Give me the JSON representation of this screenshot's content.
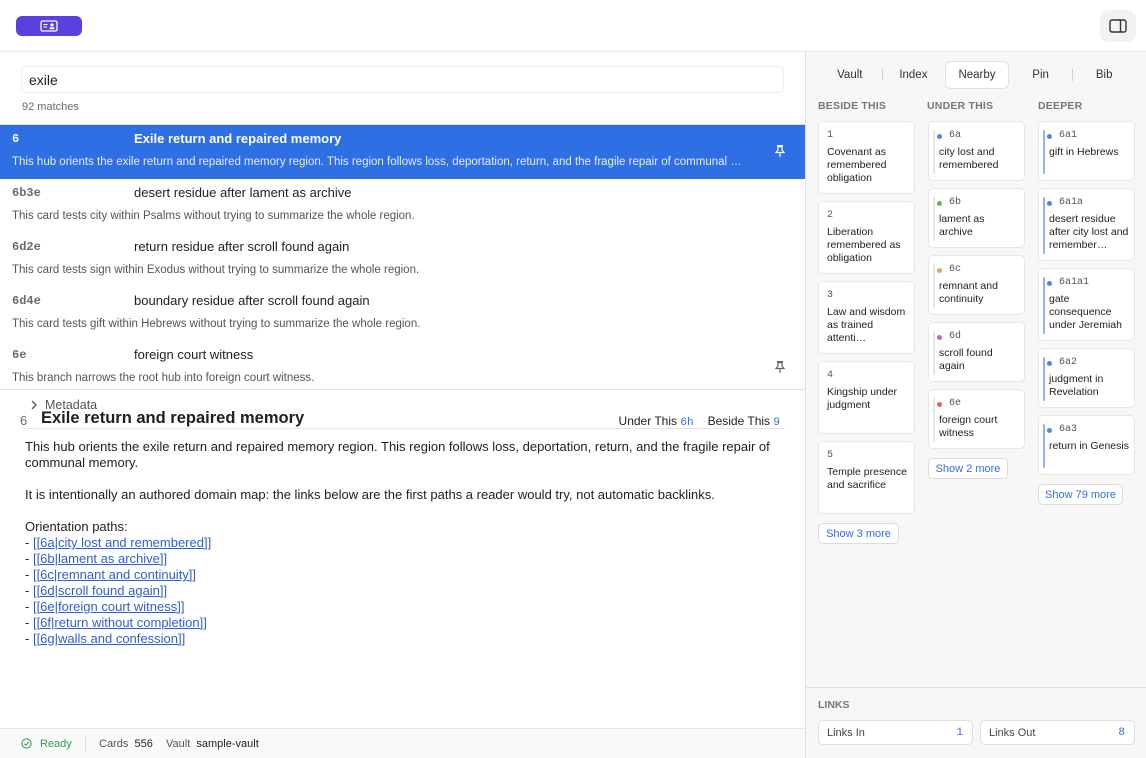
{
  "search": {
    "value": "exile",
    "match_count": "92 matches"
  },
  "results": [
    {
      "id": "6",
      "title": "Exile return and repaired memory",
      "desc": "This hub orients the exile return and repaired memory region. This region follows loss, deportation, return, and the fragile repair of communal memory.",
      "selected": true,
      "pinned": true
    },
    {
      "id": "6b3e",
      "title": "desert residue after lament as archive",
      "desc": "This card tests city within Psalms without trying to summarize the whole region.",
      "selected": false,
      "pinned": false
    },
    {
      "id": "6d2e",
      "title": "return residue after scroll found again",
      "desc": "This card tests sign within Exodus without trying to summarize the whole region.",
      "selected": false,
      "pinned": false
    },
    {
      "id": "6d4e",
      "title": "boundary residue after scroll found again",
      "desc": "This card tests gift within Hebrews without trying to summarize the whole region.",
      "selected": false,
      "pinned": false
    },
    {
      "id": "6e",
      "title": "foreign court witness",
      "desc": "This branch narrows the root hub into foreign court witness.",
      "selected": false,
      "pinned": true
    }
  ],
  "detail": {
    "id": "6",
    "title": "Exile return and repaired memory",
    "under_label": "Under This",
    "under_value": "6h",
    "beside_label": "Beside This",
    "beside_value": "9",
    "metadata_label": "Metadata",
    "para1": "This hub orients the exile return and repaired memory region. This region follows loss, deportation, return, and the fragile repair of communal memory.",
    "para2": "It is intentionally an authored domain map: the links below are the first paths a reader would try, not automatic backlinks.",
    "paths_label": "Orientation paths:",
    "paths": [
      "[[6a|city lost and remembered]]",
      "[[6b|lament as archive]]",
      "[[6c|remnant and continuity]]",
      "[[6d|scroll found again]]",
      "[[6e|foreign court witness]]",
      "[[6f|return without completion]]",
      "[[6g|walls and confession]]"
    ]
  },
  "status": {
    "ready": "Ready",
    "cards_label": "Cards",
    "cards_value": "556",
    "vault_label": "Vault",
    "vault_value": "sample-vault"
  },
  "tabs": [
    "Vault",
    "Index",
    "Nearby",
    "Pin",
    "Bib"
  ],
  "active_tab": "Nearby",
  "columns": {
    "beside": {
      "header": "BESIDE THIS",
      "cards": [
        {
          "id": "1",
          "text": "Covenant as remembered obligation"
        },
        {
          "id": "2",
          "text": "Liberation remembered as obligation"
        },
        {
          "id": "3",
          "text": "Law and wisdom as trained attenti…"
        },
        {
          "id": "4",
          "text": "Kingship under judgment"
        },
        {
          "id": "5",
          "text": "Temple presence and sacrifice"
        }
      ],
      "more": "Show 3 more"
    },
    "under": {
      "header": "UNDER THIS",
      "cards": [
        {
          "id": "6a",
          "text": "city lost and remembered",
          "color": "#4f86e8"
        },
        {
          "id": "6b",
          "text": "lament as archive",
          "color": "#55b86a"
        },
        {
          "id": "6c",
          "text": "remnant and continuity",
          "color": "#f0a24a"
        },
        {
          "id": "6d",
          "text": "scroll found again",
          "color": "#c85ad6"
        },
        {
          "id": "6e",
          "text": "foreign court witness",
          "color": "#e26565"
        }
      ],
      "more": "Show 2 more"
    },
    "deeper": {
      "header": "DEEPER",
      "cards": [
        {
          "id": "6a1",
          "text": "gift in Hebrews"
        },
        {
          "id": "6a1a",
          "text": "desert residue after city lost and remember…"
        },
        {
          "id": "6a1a1",
          "text": "gate consequence under Jeremiah"
        },
        {
          "id": "6a2",
          "text": "judgment in Revelation"
        },
        {
          "id": "6a3",
          "text": "return in Genesis"
        }
      ],
      "more": "Show 79 more"
    }
  },
  "links": {
    "header": "LINKS",
    "in_label": "Links In",
    "in_count": "1",
    "out_label": "Links Out",
    "out_count": "8"
  },
  "colors": {
    "accent": "#2f6fe4",
    "brand": "#5b3fe0",
    "deeper_bar": "#8fb3ef"
  }
}
